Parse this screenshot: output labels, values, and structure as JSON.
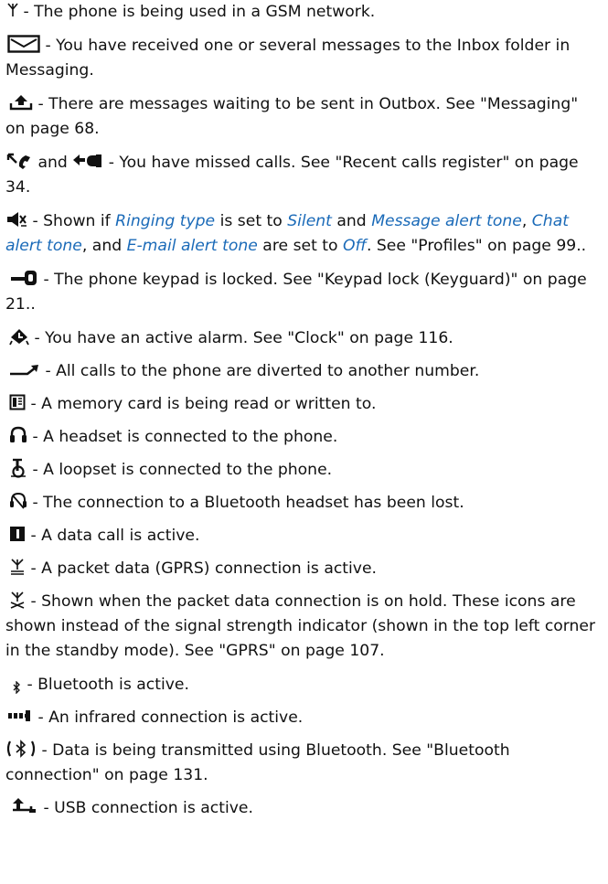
{
  "legend": {
    "gsm": {
      "dash": " - ",
      "text": "The phone is being used in a GSM network.",
      "icon": "antenna-icon"
    },
    "inbox": {
      "dash": " - ",
      "text": "You have received one or several messages to the Inbox folder in Messaging.",
      "icon": "envelope-icon"
    },
    "outbox": {
      "dash": " - ",
      "text": "There are messages waiting to be sent in Outbox. See \"Messaging\" on page 68.",
      "icon": "outbox-icon"
    },
    "missed": {
      "and": " and ",
      "dash": " - ",
      "text": "You have missed calls. See \"Recent calls register\" on page 34.",
      "icon1": "missed-call-icon",
      "icon2": "missed-call-alt-icon"
    },
    "silent": {
      "dash": " - ",
      "p1": "Shown if ",
      "ringing_type": "Ringing type",
      "p2": " is set to ",
      "silent": "Silent",
      "p3": " and ",
      "msg_tone": "Message alert tone",
      "p4": ", ",
      "chat_tone": "Chat alert tone",
      "p5": ", and ",
      "email_tone": "E-mail alert tone",
      "p6": " are set to ",
      "off": "Off",
      "p7": ". See \"Profiles\" on page 99..",
      "icon": "silent-icon",
      "highlight_color": "#1a6ab8"
    },
    "keypad": {
      "dash": " - ",
      "text": "The phone keypad is locked. See \"Keypad lock (Keyguard)\" on page 21..",
      "icon": "keylock-icon"
    },
    "alarm": {
      "dash": " - ",
      "text": "You have an active alarm. See \"Clock\" on page 116.",
      "icon": "alarm-icon"
    },
    "divert": {
      "dash": " - ",
      "text": "All calls to the phone are diverted to another number.",
      "icon": "divert-icon"
    },
    "memcard": {
      "dash": " - ",
      "text": "A memory card is being read or written to.",
      "icon": "memory-card-icon"
    },
    "headset": {
      "dash": " - ",
      "text": "A headset is connected to the phone.",
      "icon": "headset-icon"
    },
    "loopset": {
      "dash": " - ",
      "text": "A loopset is connected to the phone.",
      "icon": "loopset-icon"
    },
    "bt_lost": {
      "dash": " - ",
      "text": "The connection to a Bluetooth headset has been lost.",
      "icon": "bt-headset-lost-icon"
    },
    "data_call": {
      "dash": " - ",
      "text": "A data call is active.",
      "icon": "data-call-icon"
    },
    "gprs_active": {
      "dash": " - ",
      "text": "A packet data (GPRS) connection is active.",
      "icon": "gprs-active-icon"
    },
    "gprs_hold": {
      "dash": " - ",
      "text": "Shown when the packet data connection is on hold. These icons are shown instead of the signal strength indicator (shown in the top left corner in the standby mode). See \"GPRS\" on page 107.",
      "icon": "gprs-hold-icon"
    },
    "bt_active": {
      "dash": " - ",
      "text": "Bluetooth is active.",
      "icon": "bluetooth-icon"
    },
    "infrared": {
      "dash": " - ",
      "text": "An infrared connection is active.",
      "icon": "infrared-icon"
    },
    "bt_transmit": {
      "dash": " - ",
      "text": "Data is being transmitted using Bluetooth. See \"Bluetooth connection\" on page 131.",
      "icon": "bluetooth-transmit-icon"
    },
    "usb": {
      "dash": " - ",
      "text": "USB connection is active.",
      "icon": "usb-icon"
    }
  }
}
